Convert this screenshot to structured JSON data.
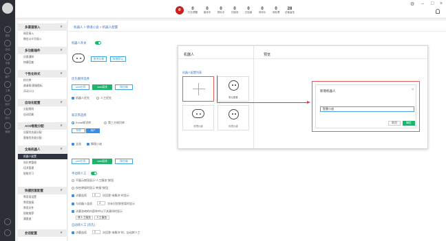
{
  "topbar": {
    "badge_letter": "e",
    "stats": [
      {
        "value": "0",
        "label": "行业提醒"
      },
      {
        "value": "0",
        "label": "接待中"
      },
      {
        "value": "0",
        "label": "排队中"
      },
      {
        "value": "0",
        "label": "已接待"
      },
      {
        "value": "0",
        "label": "已结束"
      },
      {
        "value": "0",
        "label": "待评价"
      },
      {
        "value": "0",
        "label": "待处理"
      },
      {
        "value": "28",
        "label": "访客留言"
      }
    ],
    "window_controls": {
      "settings": "⚙",
      "minimize": "–",
      "maximize": "□",
      "close": "×"
    }
  },
  "rail": {
    "items": [
      "首页",
      "会话",
      "访客",
      "客户",
      "工单",
      "知识",
      "统计",
      "营销",
      "设置",
      "帮助"
    ]
  },
  "sidebar": {
    "groups": [
      {
        "title": "多渠道接入",
        "items": [
          "网页接入",
          "微信公众号接入"
        ]
      },
      {
        "title": "多功能插件",
        "items": [
          "访客通知",
          "快捷回复"
        ]
      },
      {
        "title": "个性化样式",
        "items": [
          "样式库",
          "邀请框/客服图标",
          "浮动入口"
        ]
      },
      {
        "title": "自动化配置",
        "items": [
          "分配规则",
          "自动回复"
        ]
      },
      {
        "title": "ACD智能分配",
        "items": [
          "访客优先级分配",
          "客服优先级分配"
        ]
      },
      {
        "title": "全局机器人",
        "items": [
          "机器人配置",
          "知识库管理",
          "话术管理",
          "智能学习"
        ]
      },
      {
        "title": "快捷回复配置",
        "items": [
          "常用语设置",
          "常用链接",
          "常用文件",
          "智能推荐",
          "满意度"
        ]
      },
      {
        "title": "会话配置",
        "items": []
      }
    ],
    "active_item": "机器人配置"
  },
  "main": {
    "breadcrumb": "机器人 > 情境小迪 > 机器人配置",
    "robot_switch_label": "机器人开关",
    "change_avatar_button": "更改头像",
    "restore_default_button": "恢复默认",
    "priority_section_label": "优先顺序选择",
    "channel_tabs": [
      "web在线",
      "web离线",
      "微信端"
    ],
    "priority_options": [
      "机器人优先",
      "人工优先"
    ],
    "welcome_section_label": "知识库选择",
    "welcome_options": [
      "Echat知识库",
      "第三方知识库"
    ],
    "kb_tabs": [
      "系统",
      "用户"
    ],
    "kb_checks": [
      "全选",
      "情境小迪"
    ],
    "channel_tabs_2": [
      "web在线",
      "web离线",
      "微信端"
    ],
    "transfer_label": "手动转人工",
    "transfer_options": [
      "不展示按钮显示\"人工服务\"按钮",
      "仅在转接时显示\"转接\"按钮"
    ],
    "rule1": {
      "prefix": "访客连续",
      "value": "2",
      "suffix": "次回答\"未解决\"时显示"
    },
    "rule2": {
      "prefix": "与机器人连续",
      "value": "3",
      "suffix": "次未识别到答案时显示"
    },
    "rule3": "访客咨询的内容命中以下关键词时显示",
    "keyword_tags": [
      "转人工服务",
      "人工服务"
    ],
    "auto_transfer_label": "自动转人工 (优先)",
    "rule4": {
      "prefix": "访客连续",
      "value": "2",
      "suffix": "次回答\"未解决\"时，自动转人工"
    }
  },
  "panel": {
    "left_title": "机器人",
    "right_title": "预览",
    "list_header": "机器人配置列表",
    "robots": [
      {
        "name": "默认配置"
      },
      {
        "name": "情境小迪"
      },
      {
        "name": "情境小迪"
      }
    ]
  },
  "dialog": {
    "title": "新增机器人",
    "close": "×",
    "input_value": "智慧小迪",
    "cancel_button": "取消",
    "confirm_button": "确定"
  },
  "colors": {
    "accent": "#21b26d",
    "link": "#3b6fc4",
    "highlight": "#e03a3a",
    "sidebar_dark": "#2f3441"
  }
}
